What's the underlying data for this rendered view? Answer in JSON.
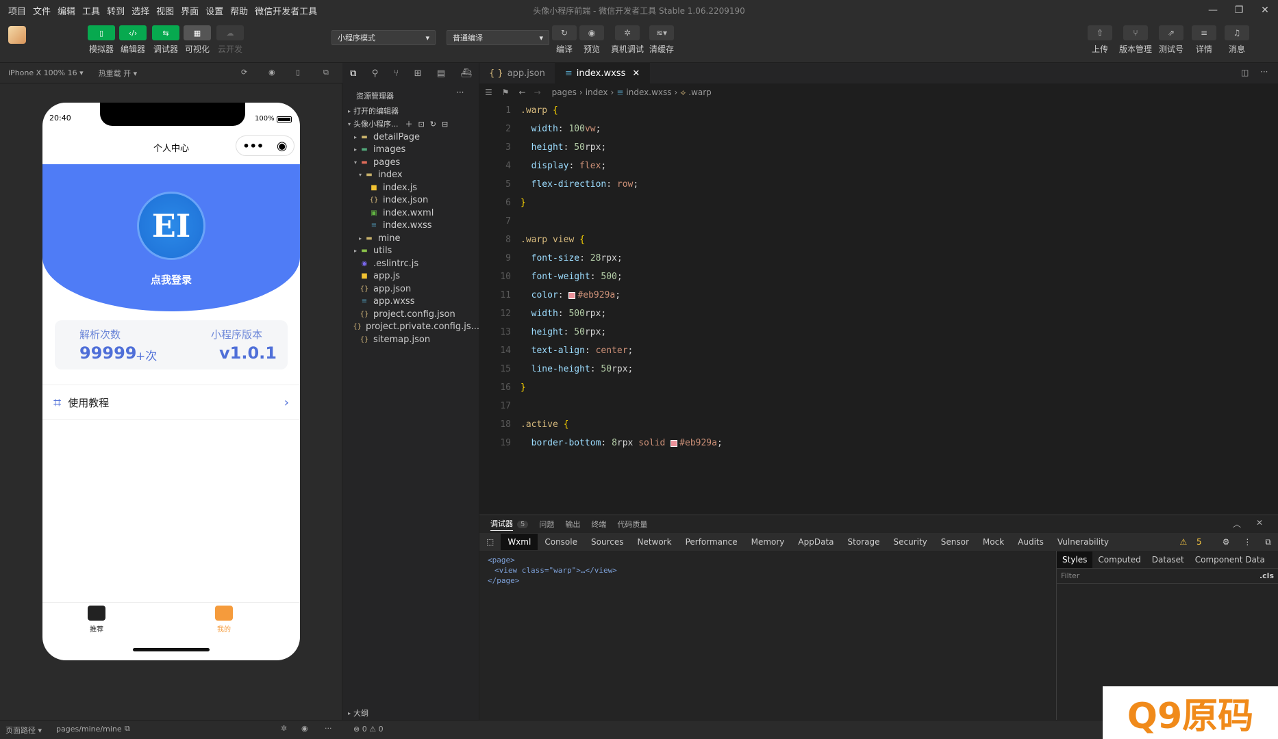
{
  "menubar": {
    "items": [
      "项目",
      "文件",
      "编辑",
      "工具",
      "转到",
      "选择",
      "视图",
      "界面",
      "设置",
      "帮助",
      "微信开发者工具"
    ],
    "window_title": "头像小程序前端 - 微信开发者工具 Stable 1.06.2209190"
  },
  "toolbar": {
    "left_buttons": [
      {
        "label": "模拟器"
      },
      {
        "label": "编辑器"
      },
      {
        "label": "调试器"
      },
      {
        "label": "可视化"
      },
      {
        "label": "云开发"
      }
    ],
    "mode_select": "小程序模式",
    "compile_select": "普通编译",
    "mid_buttons": [
      {
        "label": "编译"
      },
      {
        "label": "预览"
      },
      {
        "label": "真机调试"
      },
      {
        "label": "清缓存"
      }
    ],
    "right_buttons": [
      {
        "label": "上传"
      },
      {
        "label": "版本管理"
      },
      {
        "label": "测试号"
      },
      {
        "label": "详情"
      },
      {
        "label": "消息"
      }
    ]
  },
  "simulator": {
    "device": "iPhone X 100% 16 ▾",
    "hotreload": "热重载 开 ▾"
  },
  "phone": {
    "time": "20:40",
    "battery": "100%",
    "nav_title": "个人中心",
    "avatar_text": "EI",
    "login": "点我登录",
    "stat1_label": "解析次数",
    "stat1_value": "99999",
    "stat1_suffix": "+次",
    "stat2_label": "小程序版本",
    "stat2_value": "v1.0.1",
    "menu_item": "使用教程",
    "tab1": "推荐",
    "tab2": "我的"
  },
  "explorer": {
    "title": "资源管理器",
    "open_editors": "打开的编辑器",
    "project": "头像小程序...",
    "files": [
      {
        "name": "detailPage",
        "type": "folder",
        "depth": 1,
        "arrow": "▸"
      },
      {
        "name": "images",
        "type": "folder-img",
        "depth": 1,
        "arrow": "▸"
      },
      {
        "name": "pages",
        "type": "folder-pages",
        "depth": 1,
        "arrow": "▾"
      },
      {
        "name": "index",
        "type": "folder",
        "depth": 2,
        "arrow": "▾"
      },
      {
        "name": "index.js",
        "type": "js",
        "depth": 3,
        "arrow": ""
      },
      {
        "name": "index.json",
        "type": "json",
        "depth": 3,
        "arrow": ""
      },
      {
        "name": "index.wxml",
        "type": "wxml",
        "depth": 3,
        "arrow": ""
      },
      {
        "name": "index.wxss",
        "type": "wxss",
        "depth": 3,
        "arrow": ""
      },
      {
        "name": "mine",
        "type": "folder",
        "depth": 2,
        "arrow": "▸"
      },
      {
        "name": "utils",
        "type": "folder-utils",
        "depth": 1,
        "arrow": "▸"
      },
      {
        "name": ".eslintrc.js",
        "type": "eslint",
        "depth": 1,
        "arrow": ""
      },
      {
        "name": "app.js",
        "type": "js",
        "depth": 1,
        "arrow": ""
      },
      {
        "name": "app.json",
        "type": "json",
        "depth": 1,
        "arrow": ""
      },
      {
        "name": "app.wxss",
        "type": "wxss",
        "depth": 1,
        "arrow": ""
      },
      {
        "name": "project.config.json",
        "type": "json",
        "depth": 1,
        "arrow": ""
      },
      {
        "name": "project.private.config.js...",
        "type": "json",
        "depth": 1,
        "arrow": ""
      },
      {
        "name": "sitemap.json",
        "type": "json",
        "depth": 1,
        "arrow": ""
      }
    ],
    "outline": "大纲"
  },
  "editor": {
    "tabs": [
      {
        "label": "app.json",
        "active": false
      },
      {
        "label": "index.wxss",
        "active": true
      }
    ],
    "breadcrumb": [
      "pages",
      "index",
      "index.wxss",
      ".warp"
    ],
    "lines": [
      {
        "n": "1",
        "tokens": [
          {
            "t": ".warp ",
            "c": "sel-c"
          },
          {
            "t": "{",
            "c": "brace"
          }
        ]
      },
      {
        "n": "2",
        "tokens": [
          {
            "t": "  width",
            "c": "prop"
          },
          {
            "t": ": ",
            "c": "pun"
          },
          {
            "t": "100",
            "c": "num"
          },
          {
            "t": "vw",
            "c": "val"
          },
          {
            "t": ";",
            "c": "pun"
          }
        ]
      },
      {
        "n": "3",
        "tokens": [
          {
            "t": "  height",
            "c": "prop"
          },
          {
            "t": ": ",
            "c": "pun"
          },
          {
            "t": "50",
            "c": "num"
          },
          {
            "t": "rpx",
            "c": "pun"
          },
          {
            "t": ";",
            "c": "pun"
          }
        ]
      },
      {
        "n": "4",
        "tokens": [
          {
            "t": "  display",
            "c": "prop"
          },
          {
            "t": ": ",
            "c": "pun"
          },
          {
            "t": "flex",
            "c": "val"
          },
          {
            "t": ";",
            "c": "pun"
          }
        ]
      },
      {
        "n": "5",
        "tokens": [
          {
            "t": "  flex-direction",
            "c": "prop"
          },
          {
            "t": ": ",
            "c": "pun"
          },
          {
            "t": "row",
            "c": "val"
          },
          {
            "t": ";",
            "c": "pun"
          }
        ]
      },
      {
        "n": "6",
        "tokens": [
          {
            "t": "}",
            "c": "brace"
          }
        ]
      },
      {
        "n": "7",
        "tokens": []
      },
      {
        "n": "8",
        "tokens": [
          {
            "t": ".warp view ",
            "c": "sel-c"
          },
          {
            "t": "{",
            "c": "brace"
          }
        ]
      },
      {
        "n": "9",
        "tokens": [
          {
            "t": "  font-size",
            "c": "prop"
          },
          {
            "t": ": ",
            "c": "pun"
          },
          {
            "t": "28",
            "c": "num"
          },
          {
            "t": "rpx",
            "c": "pun"
          },
          {
            "t": ";",
            "c": "pun"
          }
        ]
      },
      {
        "n": "10",
        "tokens": [
          {
            "t": "  font-weight",
            "c": "prop"
          },
          {
            "t": ": ",
            "c": "pun"
          },
          {
            "t": "500",
            "c": "num"
          },
          {
            "t": ";",
            "c": "pun"
          }
        ]
      },
      {
        "n": "11",
        "tokens": [
          {
            "t": "  color",
            "c": "prop"
          },
          {
            "t": ": ",
            "c": "pun"
          },
          {
            "t": "#eb929a",
            "c": "val",
            "swatch": "#eb929a"
          },
          {
            "t": ";",
            "c": "pun"
          }
        ]
      },
      {
        "n": "12",
        "tokens": [
          {
            "t": "  width",
            "c": "prop"
          },
          {
            "t": ": ",
            "c": "pun"
          },
          {
            "t": "500",
            "c": "num"
          },
          {
            "t": "rpx",
            "c": "pun"
          },
          {
            "t": ";",
            "c": "pun"
          }
        ]
      },
      {
        "n": "13",
        "tokens": [
          {
            "t": "  height",
            "c": "prop"
          },
          {
            "t": ": ",
            "c": "pun"
          },
          {
            "t": "50",
            "c": "num"
          },
          {
            "t": "rpx",
            "c": "pun"
          },
          {
            "t": ";",
            "c": "pun"
          }
        ]
      },
      {
        "n": "14",
        "tokens": [
          {
            "t": "  text-align",
            "c": "prop"
          },
          {
            "t": ": ",
            "c": "pun"
          },
          {
            "t": "center",
            "c": "val"
          },
          {
            "t": ";",
            "c": "pun"
          }
        ]
      },
      {
        "n": "15",
        "tokens": [
          {
            "t": "  line-height",
            "c": "prop"
          },
          {
            "t": ": ",
            "c": "pun"
          },
          {
            "t": "50",
            "c": "num"
          },
          {
            "t": "rpx",
            "c": "pun"
          },
          {
            "t": ";",
            "c": "pun"
          }
        ]
      },
      {
        "n": "16",
        "tokens": [
          {
            "t": "}",
            "c": "brace"
          }
        ]
      },
      {
        "n": "17",
        "tokens": []
      },
      {
        "n": "18",
        "tokens": [
          {
            "t": ".active ",
            "c": "sel-c"
          },
          {
            "t": "{",
            "c": "brace"
          }
        ]
      },
      {
        "n": "19",
        "tokens": [
          {
            "t": "  border-bottom",
            "c": "prop"
          },
          {
            "t": ": ",
            "c": "pun"
          },
          {
            "t": "8",
            "c": "num"
          },
          {
            "t": "rpx ",
            "c": "pun"
          },
          {
            "t": "solid ",
            "c": "val"
          },
          {
            "t": "#eb929a",
            "c": "val",
            "swatch": "#eb929a"
          },
          {
            "t": ";",
            "c": "pun"
          }
        ]
      }
    ]
  },
  "devtools": {
    "top_tabs": [
      "调试器",
      "问题",
      "输出",
      "终端",
      "代码质量"
    ],
    "badge": "5",
    "panels": [
      "Wxml",
      "Console",
      "Sources",
      "Network",
      "Performance",
      "Memory",
      "AppData",
      "Storage",
      "Security",
      "Sensor",
      "Mock",
      "Audits",
      "Vulnerability"
    ],
    "warn_count": "5",
    "xml_lines": [
      "<page>",
      "<view class=\"warp\">…</view>",
      "</page>"
    ],
    "side_tabs": [
      "Styles",
      "Computed",
      "Dataset",
      "Component Data"
    ],
    "filter_placeholder": "Filter",
    "cls": ".cls"
  },
  "statusbar": {
    "path_label": "页面路径 ▾",
    "path": "pages/mine/mine",
    "errors": "0",
    "warnings": "0"
  },
  "watermark": "Q9原码"
}
